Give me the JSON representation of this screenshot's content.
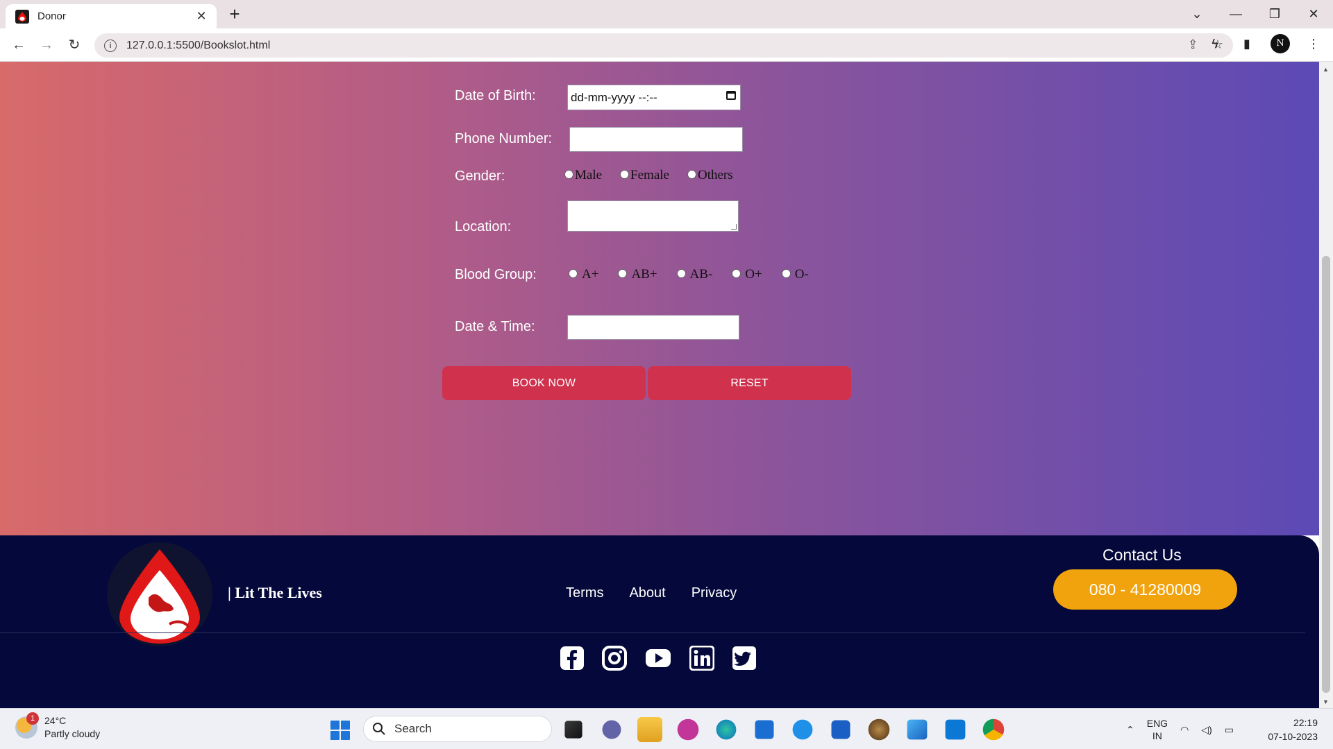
{
  "browser": {
    "tab_title": "Donor",
    "url": "127.0.0.1:5500/Bookslot.html",
    "profile_initial": "N"
  },
  "form": {
    "dob_label": "Date of Birth:",
    "dob_value": "dd-mm-yyyy --:--",
    "phone_label": "Phone Number:",
    "gender_label": "Gender:",
    "gender_options": [
      "Male",
      "Female",
      "Others"
    ],
    "location_label": "Location:",
    "blood_label": "Blood Group:",
    "blood_options": [
      "A+",
      "AB+",
      "AB-",
      "O+",
      "O-"
    ],
    "datetime_label": "Date & Time:",
    "book_button": "BOOK NOW",
    "reset_button": "RESET"
  },
  "footer": {
    "brand": "| Lit The Lives",
    "links": [
      "Terms",
      "About",
      "Privacy"
    ],
    "contact_title": "Contact Us",
    "phone": "080 - 41280009",
    "socials": [
      "facebook-icon",
      "instagram-icon",
      "youtube-icon",
      "linkedin-icon",
      "twitter-icon"
    ]
  },
  "taskbar": {
    "weather_temp": "24°C",
    "weather_desc": "Partly cloudy",
    "weather_badge": "1",
    "search_placeholder": "Search",
    "lang_top": "ENG",
    "lang_bottom": "IN",
    "time": "22:19",
    "date": "07-10-2023"
  },
  "colors": {
    "gradient_start": "#d86a6a",
    "gradient_end": "#5c4ab5",
    "button": "#d0324e",
    "footer_bg": "#05083a",
    "phone_button": "#f0a30c"
  }
}
